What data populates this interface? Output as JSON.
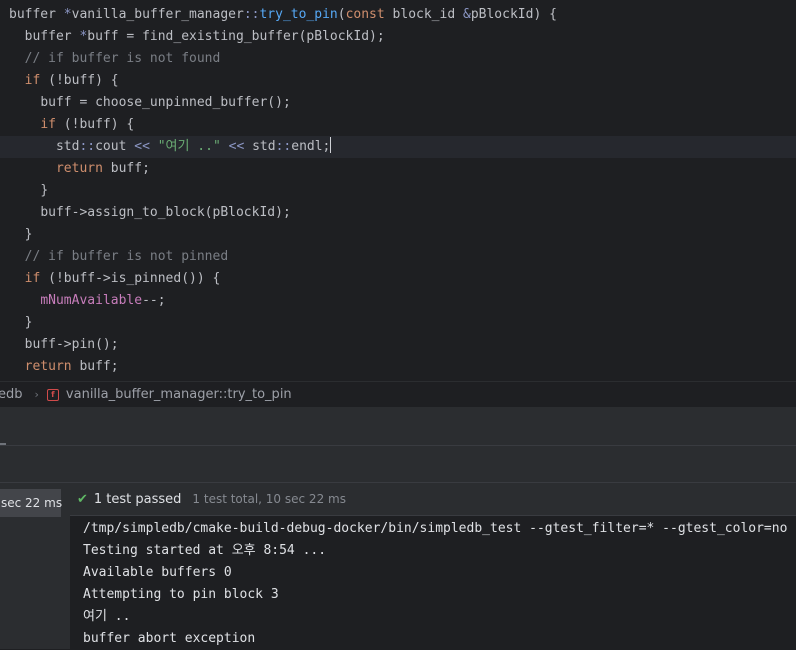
{
  "editor": {
    "lines": [
      {
        "indent": "",
        "tokens": [
          [
            "ty",
            "buffer "
          ],
          [
            "op",
            "*"
          ],
          [
            "ty",
            "vanilla_buffer_manager"
          ],
          [
            "op",
            "::"
          ],
          [
            "fn",
            "try_to_pin"
          ],
          [
            "ty",
            "("
          ],
          [
            "kw",
            "const "
          ],
          [
            "ty",
            "block_id "
          ],
          [
            "op",
            "&"
          ],
          [
            "ty",
            "pBlockId) {"
          ]
        ]
      },
      {
        "indent": "  ",
        "tokens": [
          [
            "ty",
            "buffer "
          ],
          [
            "op",
            "*"
          ],
          [
            "ty",
            "buff = find_existing_buffer(pBlockId);"
          ]
        ]
      },
      {
        "indent": "  ",
        "tokens": [
          [
            "cm",
            "// if buffer is not found"
          ]
        ]
      },
      {
        "indent": "  ",
        "tokens": [
          [
            "kw",
            "if "
          ],
          [
            "ty",
            "(!buff) {"
          ]
        ]
      },
      {
        "indent": "    ",
        "tokens": [
          [
            "ty",
            "buff = choose_unpinned_buffer();"
          ]
        ]
      },
      {
        "indent": "    ",
        "tokens": [
          [
            "kw",
            "if "
          ],
          [
            "ty",
            "(!buff) {"
          ]
        ]
      },
      {
        "indent": "      ",
        "tokens": [
          [
            "ty",
            "std"
          ],
          [
            "op",
            "::"
          ],
          [
            "ty",
            "cout "
          ],
          [
            "op",
            "<< "
          ],
          [
            "st",
            "\"여기 ..\" "
          ],
          [
            "op",
            "<< "
          ],
          [
            "ty",
            "std"
          ],
          [
            "op",
            "::"
          ],
          [
            "ty",
            "endl;"
          ]
        ],
        "current": true
      },
      {
        "indent": "      ",
        "tokens": [
          [
            "kw",
            "return "
          ],
          [
            "ty",
            "buff;"
          ]
        ]
      },
      {
        "indent": "    ",
        "tokens": [
          [
            "ty",
            "}"
          ]
        ]
      },
      {
        "indent": "    ",
        "tokens": [
          [
            "ty",
            "buff->assign_to_block(pBlockId);"
          ]
        ]
      },
      {
        "indent": "  ",
        "tokens": [
          [
            "ty",
            "}"
          ]
        ]
      },
      {
        "indent": "  ",
        "tokens": [
          [
            "cm",
            "// if buffer is not pinned"
          ]
        ]
      },
      {
        "indent": "  ",
        "tokens": [
          [
            "kw",
            "if "
          ],
          [
            "ty",
            "(!buff->is_pinned()) {"
          ]
        ]
      },
      {
        "indent": "    ",
        "tokens": [
          [
            "fld",
            "mNumAvailable"
          ],
          [
            "ty",
            "--;"
          ]
        ]
      },
      {
        "indent": "  ",
        "tokens": [
          [
            "ty",
            "}"
          ]
        ]
      },
      {
        "indent": "  ",
        "tokens": [
          [
            "ty",
            "buff->pin();"
          ]
        ]
      },
      {
        "indent": "  ",
        "tokens": [
          [
            "kw",
            "return "
          ],
          [
            "ty",
            "buff;"
          ]
        ]
      }
    ]
  },
  "breadcrumb": {
    "project": "edb",
    "function_icon": "function-icon",
    "function_label": "f",
    "function": "vanilla_buffer_manager::try_to_pin"
  },
  "test_tree": {
    "duration": "sec 22 ms"
  },
  "status": {
    "check_icon": "check-icon",
    "passed": "1 test passed",
    "total": "1 test total, 10 sec 22 ms"
  },
  "console": {
    "lines": [
      "/tmp/simpledb/cmake-build-debug-docker/bin/simpledb_test --gtest_filter=* --gtest_color=no",
      "Testing started at 오후 8:54 ...",
      "Available buffers 0",
      "Attempting to pin block 3",
      "여기 ..",
      "buffer abort exception"
    ]
  },
  "colors": {
    "background": "#1e1f22",
    "panel": "#2b2d30",
    "keyword": "#cf8e6d",
    "function": "#56a8f5",
    "comment": "#7a7e85",
    "string": "#6aab73",
    "field": "#c77dbb",
    "success": "#5fb865"
  }
}
